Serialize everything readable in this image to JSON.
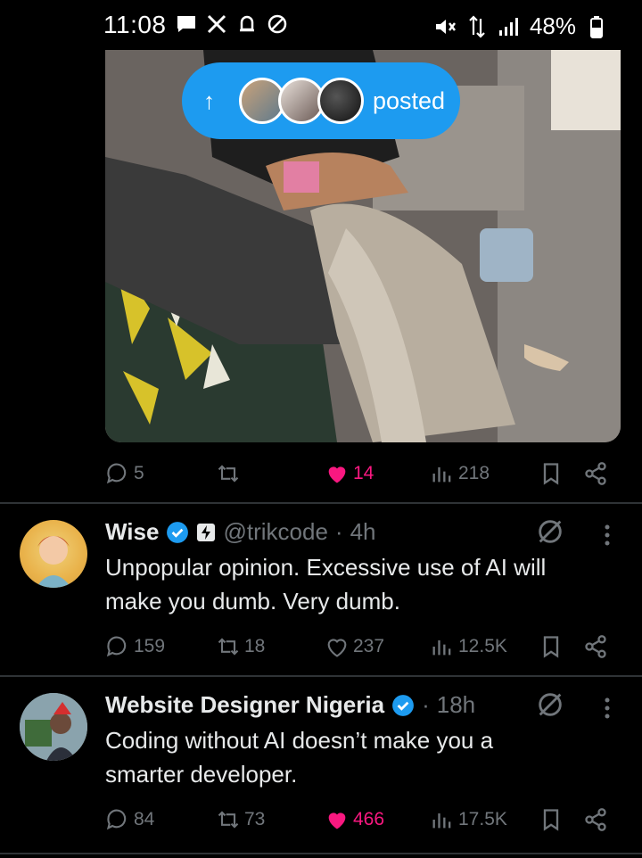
{
  "status_bar": {
    "time": "11:08",
    "battery": "48%"
  },
  "top_post": {
    "posted_pill": {
      "label": "posted"
    },
    "actions": {
      "replies": "5",
      "reposts": "",
      "likes": "14",
      "views": "218"
    }
  },
  "tweets": [
    {
      "name": "Wise",
      "handle": "@trikcode",
      "dot": "·",
      "time": "4h",
      "text_line1": "Unpopular opinion. Excessive use of AI will",
      "text_line2": "make you dumb. Very dumb.",
      "actions": {
        "replies": "159",
        "reposts": "18",
        "likes": "237",
        "views": "12.5K"
      },
      "liked": false
    },
    {
      "name": "Website Designer Nigeria",
      "handle": "",
      "dot": "·",
      "time": "18h",
      "text_line1": "Coding without AI doesn’t make you a",
      "text_line2": "smarter developer.",
      "actions": {
        "replies": "84",
        "reposts": "73",
        "likes": "466",
        "views": "17.5K"
      },
      "liked": true
    }
  ],
  "colors": {
    "accent": "#1d9bf0",
    "like": "#f91880",
    "muted": "#71767b"
  }
}
